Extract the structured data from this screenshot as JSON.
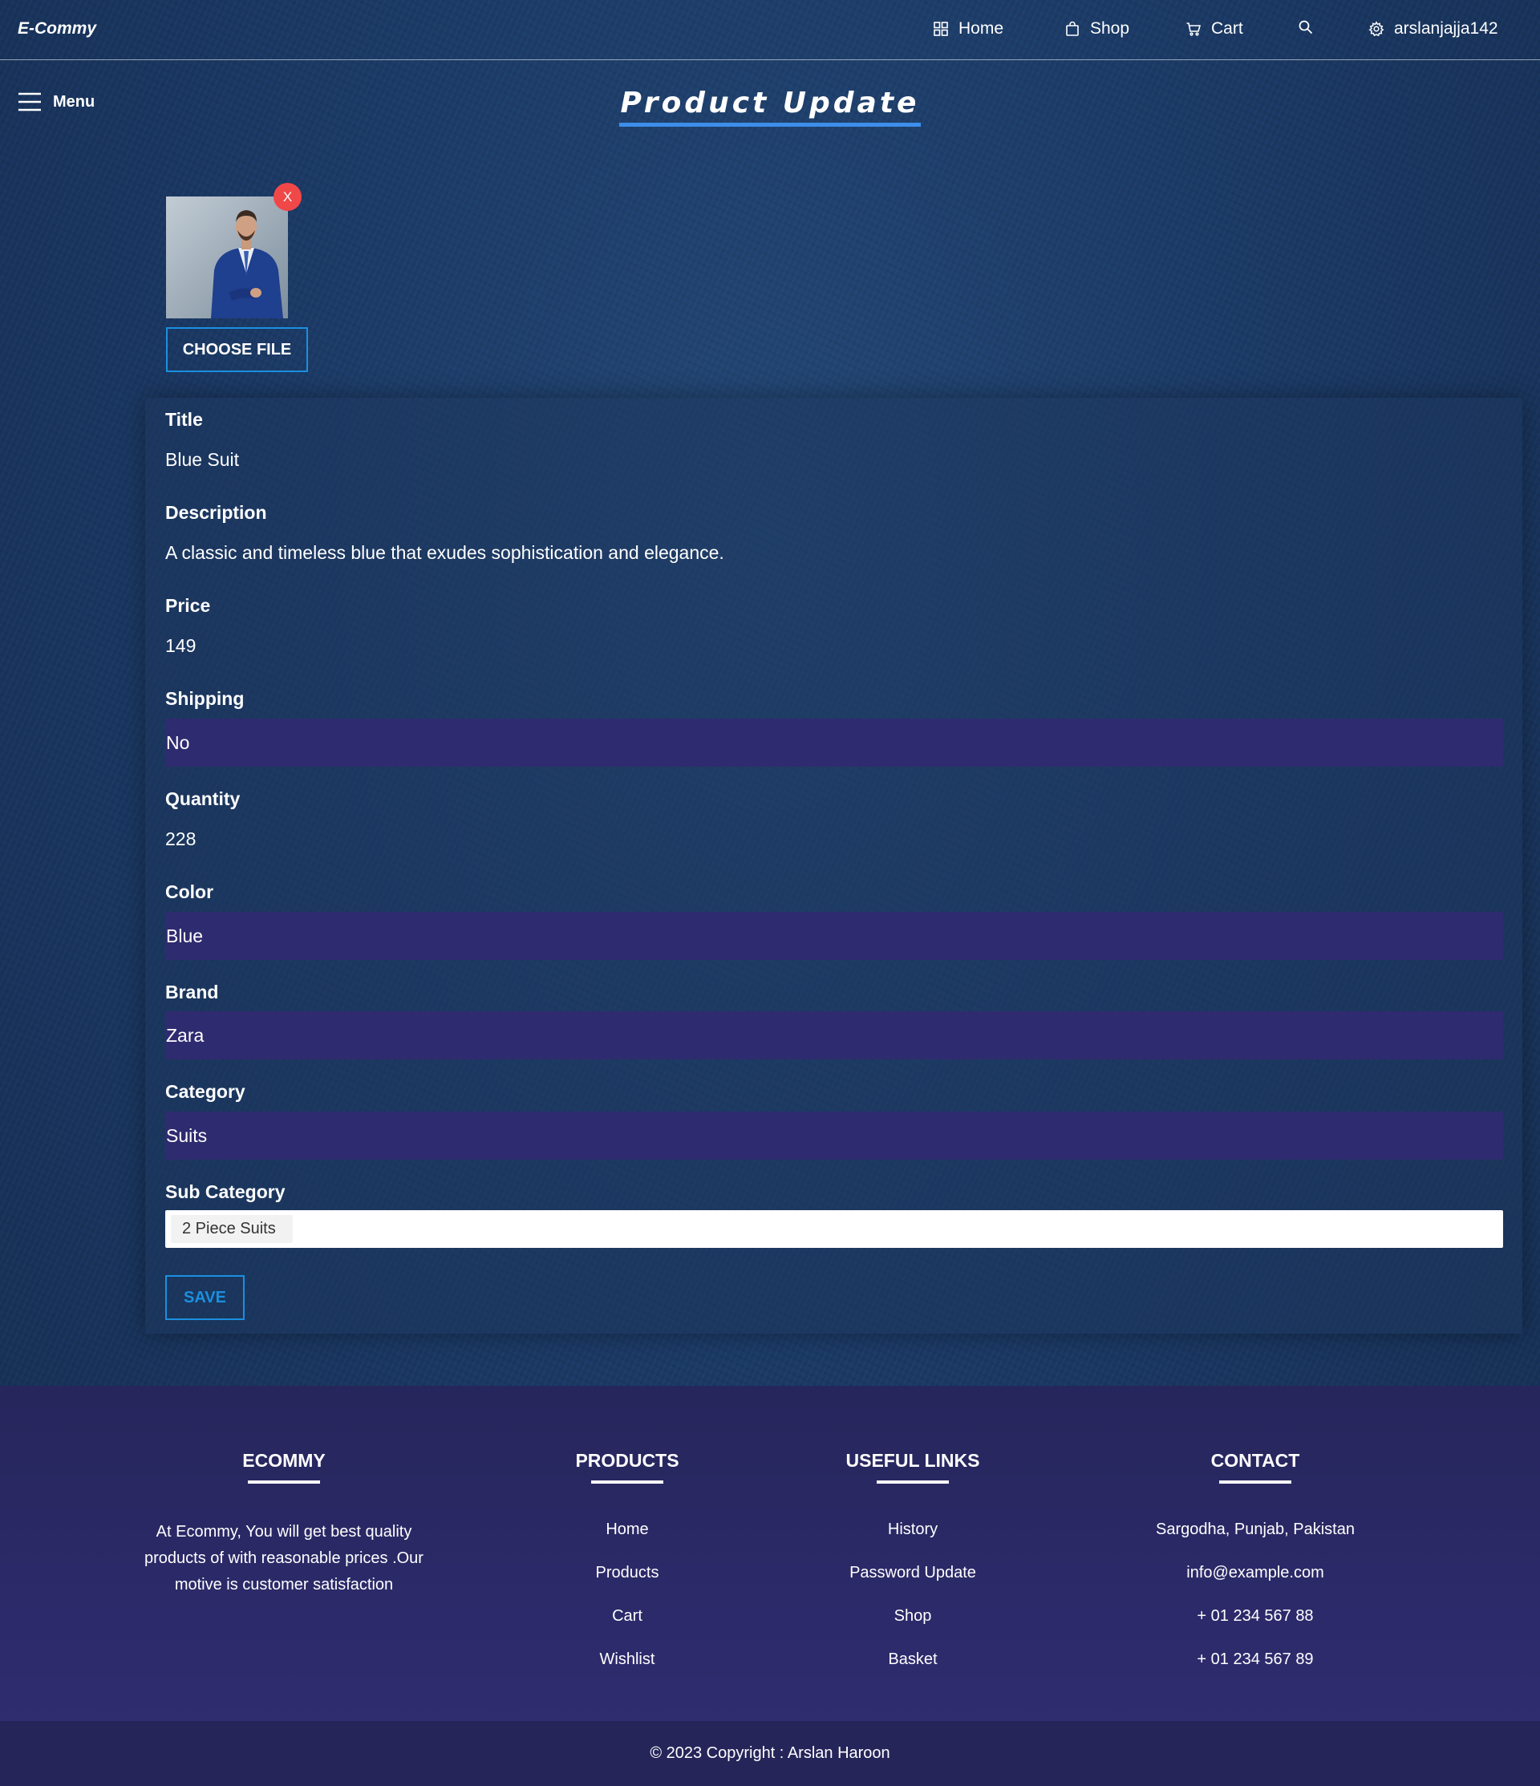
{
  "navbar": {
    "brand": "E-Commy",
    "home": "Home",
    "shop": "Shop",
    "cart": "Cart",
    "username": "arslanjajja142"
  },
  "menu": {
    "label": "Menu"
  },
  "page": {
    "title": "Product Update"
  },
  "image_upload": {
    "remove_label": "X",
    "choose_label": "CHOOSE FILE"
  },
  "form": {
    "title": {
      "label": "Title",
      "value": "Blue Suit"
    },
    "description": {
      "label": "Description",
      "value": "A classic and timeless blue that exudes sophistication and elegance."
    },
    "price": {
      "label": "Price",
      "value": "149"
    },
    "shipping": {
      "label": "Shipping",
      "value": "No"
    },
    "quantity": {
      "label": "Quantity",
      "value": "228"
    },
    "color": {
      "label": "Color",
      "value": "Blue"
    },
    "brand": {
      "label": "Brand",
      "value": "Zara"
    },
    "category": {
      "label": "Category",
      "value": "Suits"
    },
    "sub_category": {
      "label": "Sub Category",
      "selected": "2 Piece Suits"
    },
    "save_label": "SAVE"
  },
  "footer": {
    "about": {
      "heading": "ECOMMY",
      "text": "At Ecommy, You will get best quality products of with reasonable prices .Our motive is customer satisfaction"
    },
    "products": {
      "heading": "PRODUCTS",
      "links": [
        "Home",
        "Products",
        "Cart",
        "Wishlist"
      ]
    },
    "useful_links": {
      "heading": "USEFUL LINKS",
      "links": [
        "History",
        "Password Update",
        "Shop",
        "Basket"
      ]
    },
    "contact": {
      "heading": "CONTACT",
      "items": [
        "Sargodha, Punjab, Pakistan",
        "info@example.com",
        "+ 01 234 567 88",
        "+ 01 234 567 89"
      ]
    },
    "copyright": "© 2023 Copyright : Arslan Haroon"
  },
  "colors": {
    "accent": "#1b8fe0",
    "title_underline": "#3d8eea",
    "select_bg": "#2f2b70",
    "remove_badge": "#f04848",
    "footer_bg": "#2f2c70"
  }
}
